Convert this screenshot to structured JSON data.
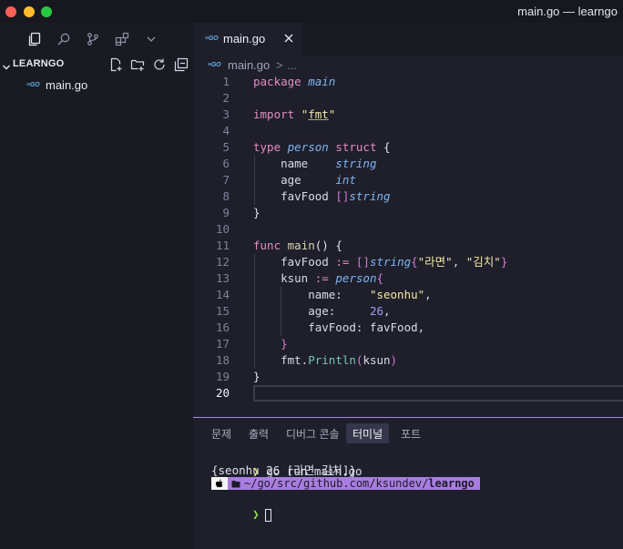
{
  "window": {
    "title": "main.go — learngo"
  },
  "sidebar": {
    "root_label": "LEARNGO",
    "files": [
      {
        "badge": "GO",
        "name": "main.go"
      }
    ]
  },
  "editor": {
    "tab": {
      "badge": "GO",
      "label": "main.go"
    },
    "breadcrumb": {
      "badge": "GO",
      "file": "main.go",
      "separator": ">",
      "more": "..."
    },
    "active_line": 20,
    "lines": [
      {
        "n": "1",
        "tokens": [
          [
            "kw",
            "package"
          ],
          [
            "pl",
            " "
          ],
          [
            "ty",
            "main"
          ]
        ]
      },
      {
        "n": "2",
        "tokens": []
      },
      {
        "n": "3",
        "tokens": [
          [
            "kw",
            "import"
          ],
          [
            "pl",
            " "
          ],
          [
            "str",
            "\""
          ],
          [
            "str-ul",
            "fmt"
          ],
          [
            "str",
            "\""
          ]
        ]
      },
      {
        "n": "4",
        "tokens": []
      },
      {
        "n": "5",
        "tokens": [
          [
            "kw",
            "type"
          ],
          [
            "pl",
            " "
          ],
          [
            "ty",
            "person"
          ],
          [
            "pl",
            " "
          ],
          [
            "kw",
            "struct"
          ],
          [
            "pl",
            " "
          ],
          [
            "pun",
            "{"
          ]
        ]
      },
      {
        "n": "6",
        "tokens": [
          [
            "pl",
            "    name    "
          ],
          [
            "ty",
            "string"
          ]
        ]
      },
      {
        "n": "7",
        "tokens": [
          [
            "pl",
            "    age     "
          ],
          [
            "ty",
            "int"
          ]
        ]
      },
      {
        "n": "8",
        "tokens": [
          [
            "pl",
            "    favFood "
          ],
          [
            "br",
            "[]"
          ],
          [
            "ty",
            "string"
          ]
        ]
      },
      {
        "n": "9",
        "tokens": [
          [
            "pun",
            "}"
          ]
        ]
      },
      {
        "n": "10",
        "tokens": []
      },
      {
        "n": "11",
        "tokens": [
          [
            "kw",
            "func"
          ],
          [
            "pl",
            " "
          ],
          [
            "fn",
            "main"
          ],
          [
            "pun",
            "() {"
          ]
        ]
      },
      {
        "n": "12",
        "tokens": [
          [
            "pl",
            "    favFood "
          ],
          [
            "kw",
            ":="
          ],
          [
            "pl",
            " "
          ],
          [
            "br",
            "[]"
          ],
          [
            "ty",
            "string"
          ],
          [
            "br",
            "{"
          ],
          [
            "str",
            "\"라면\""
          ],
          [
            "pl",
            ", "
          ],
          [
            "str",
            "\"김치\""
          ],
          [
            "br",
            "}"
          ]
        ]
      },
      {
        "n": "13",
        "tokens": [
          [
            "pl",
            "    ksun "
          ],
          [
            "kw",
            ":="
          ],
          [
            "pl",
            " "
          ],
          [
            "ty",
            "person"
          ],
          [
            "br",
            "{"
          ]
        ]
      },
      {
        "n": "14",
        "tokens": [
          [
            "pl",
            "        name:    "
          ],
          [
            "str",
            "\"seonhu\""
          ],
          [
            "pl",
            ","
          ]
        ]
      },
      {
        "n": "15",
        "tokens": [
          [
            "pl",
            "        age:     "
          ],
          [
            "num",
            "26"
          ],
          [
            "pl",
            ","
          ]
        ]
      },
      {
        "n": "16",
        "tokens": [
          [
            "pl",
            "        favFood: favFood,"
          ]
        ]
      },
      {
        "n": "17",
        "tokens": [
          [
            "br",
            "    }"
          ]
        ]
      },
      {
        "n": "18",
        "tokens": [
          [
            "pl",
            "    fmt."
          ],
          [
            "call",
            "Println"
          ],
          [
            "br",
            "("
          ],
          [
            "pl",
            "ksun"
          ],
          [
            "br",
            ")"
          ]
        ]
      },
      {
        "n": "19",
        "tokens": [
          [
            "pun",
            "}"
          ]
        ]
      },
      {
        "n": "20",
        "tokens": []
      }
    ]
  },
  "panel": {
    "tabs": [
      {
        "label": "문제",
        "active": false
      },
      {
        "label": "출력",
        "active": false
      },
      {
        "label": "디버그 콘솔",
        "active": false
      },
      {
        "label": "터미널",
        "active": true
      },
      {
        "label": "포트",
        "active": false
      }
    ],
    "terminal": {
      "prompt_symbol": "❯",
      "command": "go run main.go",
      "output": "{seonhu 26 [라면 김치]}",
      "path_prefix": "~/go/src/github.com/ksundev/",
      "path_bold": "learngo"
    }
  },
  "colors": {
    "bg_editor": "#1e1f2b",
    "bg_sidebar": "#191a22",
    "accent": "#a97de0",
    "go_badge": "#5fb3e6"
  }
}
